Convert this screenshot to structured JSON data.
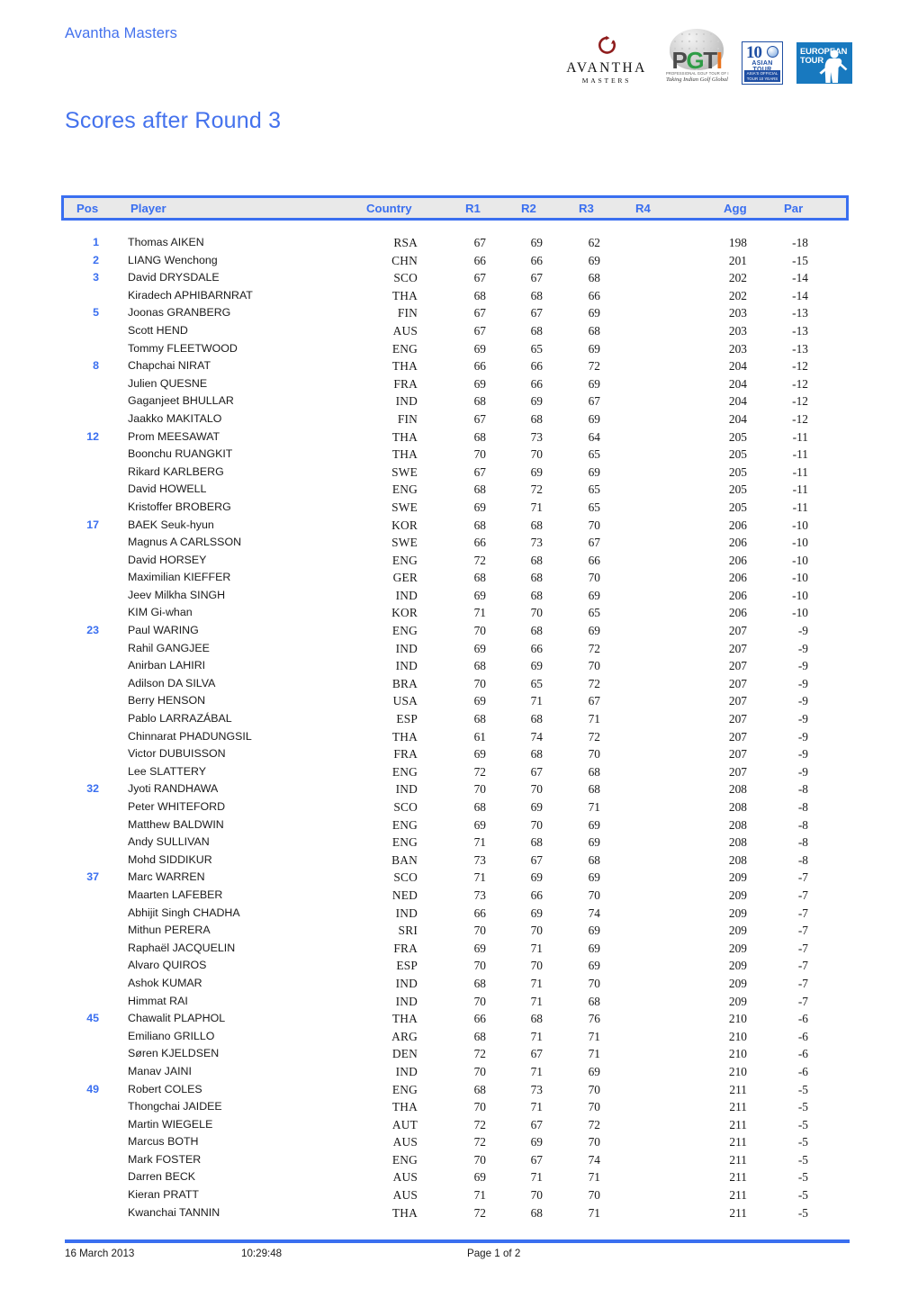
{
  "header": {
    "event_name": "Avantha Masters",
    "logos": [
      {
        "name": "avantha-masters-logo",
        "wordmark": "AVANTHA",
        "submark": "MASTERS"
      },
      {
        "name": "pgti-logo",
        "letters": [
          "P",
          "G",
          "T",
          "I"
        ],
        "tagline": "PROFESSIONAL GOLF TOUR OF INDIA",
        "script": "Taking Indian Golf Global"
      },
      {
        "name": "asian-tour-logo",
        "numeral": "10",
        "word": "ASIAN TOUR",
        "banner": "ASIA'S OFFICIAL TOUR 10 YEARS OF FOUNDATION"
      },
      {
        "name": "european-tour-logo",
        "line1": "EUROPEAN",
        "line2": "TOUR"
      }
    ]
  },
  "title": "Scores after Round 3",
  "table": {
    "columns": [
      {
        "key": "pos",
        "label": "Pos"
      },
      {
        "key": "player",
        "label": "Player"
      },
      {
        "key": "country",
        "label": "Country"
      },
      {
        "key": "r1",
        "label": "R1"
      },
      {
        "key": "r2",
        "label": "R2"
      },
      {
        "key": "r3",
        "label": "R3"
      },
      {
        "key": "r4",
        "label": "R4"
      },
      {
        "key": "agg",
        "label": "Agg"
      },
      {
        "key": "par",
        "label": "Par"
      }
    ],
    "rows": [
      {
        "pos": "1",
        "player": "Thomas AIKEN",
        "country": "RSA",
        "r1": "67",
        "r2": "69",
        "r3": "62",
        "r4": "",
        "agg": "198",
        "par": "-18"
      },
      {
        "pos": "2",
        "player": "LIANG Wenchong",
        "country": "CHN",
        "r1": "66",
        "r2": "66",
        "r3": "69",
        "r4": "",
        "agg": "201",
        "par": "-15"
      },
      {
        "pos": "3",
        "player": "David DRYSDALE",
        "country": "SCO",
        "r1": "67",
        "r2": "67",
        "r3": "68",
        "r4": "",
        "agg": "202",
        "par": "-14"
      },
      {
        "pos": "",
        "player": "Kiradech APHIBARNRAT",
        "country": "THA",
        "r1": "68",
        "r2": "68",
        "r3": "66",
        "r4": "",
        "agg": "202",
        "par": "-14"
      },
      {
        "pos": "5",
        "player": "Joonas GRANBERG",
        "country": "FIN",
        "r1": "67",
        "r2": "67",
        "r3": "69",
        "r4": "",
        "agg": "203",
        "par": "-13"
      },
      {
        "pos": "",
        "player": "Scott HEND",
        "country": "AUS",
        "r1": "67",
        "r2": "68",
        "r3": "68",
        "r4": "",
        "agg": "203",
        "par": "-13"
      },
      {
        "pos": "",
        "player": "Tommy FLEETWOOD",
        "country": "ENG",
        "r1": "69",
        "r2": "65",
        "r3": "69",
        "r4": "",
        "agg": "203",
        "par": "-13"
      },
      {
        "pos": "8",
        "player": "Chapchai NIRAT",
        "country": "THA",
        "r1": "66",
        "r2": "66",
        "r3": "72",
        "r4": "",
        "agg": "204",
        "par": "-12"
      },
      {
        "pos": "",
        "player": "Julien QUESNE",
        "country": "FRA",
        "r1": "69",
        "r2": "66",
        "r3": "69",
        "r4": "",
        "agg": "204",
        "par": "-12"
      },
      {
        "pos": "",
        "player": "Gaganjeet BHULLAR",
        "country": "IND",
        "r1": "68",
        "r2": "69",
        "r3": "67",
        "r4": "",
        "agg": "204",
        "par": "-12"
      },
      {
        "pos": "",
        "player": "Jaakko MAKITALO",
        "country": "FIN",
        "r1": "67",
        "r2": "68",
        "r3": "69",
        "r4": "",
        "agg": "204",
        "par": "-12"
      },
      {
        "pos": "12",
        "player": "Prom MEESAWAT",
        "country": "THA",
        "r1": "68",
        "r2": "73",
        "r3": "64",
        "r4": "",
        "agg": "205",
        "par": "-11"
      },
      {
        "pos": "",
        "player": "Boonchu RUANGKIT",
        "country": "THA",
        "r1": "70",
        "r2": "70",
        "r3": "65",
        "r4": "",
        "agg": "205",
        "par": "-11"
      },
      {
        "pos": "",
        "player": "Rikard KARLBERG",
        "country": "SWE",
        "r1": "67",
        "r2": "69",
        "r3": "69",
        "r4": "",
        "agg": "205",
        "par": "-11"
      },
      {
        "pos": "",
        "player": "David HOWELL",
        "country": "ENG",
        "r1": "68",
        "r2": "72",
        "r3": "65",
        "r4": "",
        "agg": "205",
        "par": "-11"
      },
      {
        "pos": "",
        "player": "Kristoffer BROBERG",
        "country": "SWE",
        "r1": "69",
        "r2": "71",
        "r3": "65",
        "r4": "",
        "agg": "205",
        "par": "-11"
      },
      {
        "pos": "17",
        "player": "BAEK Seuk-hyun",
        "country": "KOR",
        "r1": "68",
        "r2": "68",
        "r3": "70",
        "r4": "",
        "agg": "206",
        "par": "-10"
      },
      {
        "pos": "",
        "player": "Magnus A CARLSSON",
        "country": "SWE",
        "r1": "66",
        "r2": "73",
        "r3": "67",
        "r4": "",
        "agg": "206",
        "par": "-10"
      },
      {
        "pos": "",
        "player": "David HORSEY",
        "country": "ENG",
        "r1": "72",
        "r2": "68",
        "r3": "66",
        "r4": "",
        "agg": "206",
        "par": "-10"
      },
      {
        "pos": "",
        "player": "Maximilian KIEFFER",
        "country": "GER",
        "r1": "68",
        "r2": "68",
        "r3": "70",
        "r4": "",
        "agg": "206",
        "par": "-10"
      },
      {
        "pos": "",
        "player": "Jeev Milkha SINGH",
        "country": "IND",
        "r1": "69",
        "r2": "68",
        "r3": "69",
        "r4": "",
        "agg": "206",
        "par": "-10"
      },
      {
        "pos": "",
        "player": "KIM Gi-whan",
        "country": "KOR",
        "r1": "71",
        "r2": "70",
        "r3": "65",
        "r4": "",
        "agg": "206",
        "par": "-10"
      },
      {
        "pos": "23",
        "player": "Paul WARING",
        "country": "ENG",
        "r1": "70",
        "r2": "68",
        "r3": "69",
        "r4": "",
        "agg": "207",
        "par": "-9"
      },
      {
        "pos": "",
        "player": "Rahil GANGJEE",
        "country": "IND",
        "r1": "69",
        "r2": "66",
        "r3": "72",
        "r4": "",
        "agg": "207",
        "par": "-9"
      },
      {
        "pos": "",
        "player": "Anirban LAHIRI",
        "country": "IND",
        "r1": "68",
        "r2": "69",
        "r3": "70",
        "r4": "",
        "agg": "207",
        "par": "-9"
      },
      {
        "pos": "",
        "player": "Adilson DA SILVA",
        "country": "BRA",
        "r1": "70",
        "r2": "65",
        "r3": "72",
        "r4": "",
        "agg": "207",
        "par": "-9"
      },
      {
        "pos": "",
        "player": "Berry HENSON",
        "country": "USA",
        "r1": "69",
        "r2": "71",
        "r3": "67",
        "r4": "",
        "agg": "207",
        "par": "-9"
      },
      {
        "pos": "",
        "player": "Pablo LARRAZÁBAL",
        "country": "ESP",
        "r1": "68",
        "r2": "68",
        "r3": "71",
        "r4": "",
        "agg": "207",
        "par": "-9"
      },
      {
        "pos": "",
        "player": "Chinnarat PHADUNGSIL",
        "country": "THA",
        "r1": "61",
        "r2": "74",
        "r3": "72",
        "r4": "",
        "agg": "207",
        "par": "-9"
      },
      {
        "pos": "",
        "player": "Victor DUBUISSON",
        "country": "FRA",
        "r1": "69",
        "r2": "68",
        "r3": "70",
        "r4": "",
        "agg": "207",
        "par": "-9"
      },
      {
        "pos": "",
        "player": "Lee SLATTERY",
        "country": "ENG",
        "r1": "72",
        "r2": "67",
        "r3": "68",
        "r4": "",
        "agg": "207",
        "par": "-9"
      },
      {
        "pos": "32",
        "player": "Jyoti RANDHAWA",
        "country": "IND",
        "r1": "70",
        "r2": "70",
        "r3": "68",
        "r4": "",
        "agg": "208",
        "par": "-8"
      },
      {
        "pos": "",
        "player": "Peter WHITEFORD",
        "country": "SCO",
        "r1": "68",
        "r2": "69",
        "r3": "71",
        "r4": "",
        "agg": "208",
        "par": "-8"
      },
      {
        "pos": "",
        "player": "Matthew BALDWIN",
        "country": "ENG",
        "r1": "69",
        "r2": "70",
        "r3": "69",
        "r4": "",
        "agg": "208",
        "par": "-8"
      },
      {
        "pos": "",
        "player": "Andy SULLIVAN",
        "country": "ENG",
        "r1": "71",
        "r2": "68",
        "r3": "69",
        "r4": "",
        "agg": "208",
        "par": "-8"
      },
      {
        "pos": "",
        "player": "Mohd SIDDIKUR",
        "country": "BAN",
        "r1": "73",
        "r2": "67",
        "r3": "68",
        "r4": "",
        "agg": "208",
        "par": "-8"
      },
      {
        "pos": "37",
        "player": "Marc WARREN",
        "country": "SCO",
        "r1": "71",
        "r2": "69",
        "r3": "69",
        "r4": "",
        "agg": "209",
        "par": "-7"
      },
      {
        "pos": "",
        "player": "Maarten LAFEBER",
        "country": "NED",
        "r1": "73",
        "r2": "66",
        "r3": "70",
        "r4": "",
        "agg": "209",
        "par": "-7"
      },
      {
        "pos": "",
        "player": "Abhijit Singh CHADHA",
        "country": "IND",
        "r1": "66",
        "r2": "69",
        "r3": "74",
        "r4": "",
        "agg": "209",
        "par": "-7"
      },
      {
        "pos": "",
        "player": "Mithun PERERA",
        "country": "SRI",
        "r1": "70",
        "r2": "70",
        "r3": "69",
        "r4": "",
        "agg": "209",
        "par": "-7"
      },
      {
        "pos": "",
        "player": "Raphaël JACQUELIN",
        "country": "FRA",
        "r1": "69",
        "r2": "71",
        "r3": "69",
        "r4": "",
        "agg": "209",
        "par": "-7"
      },
      {
        "pos": "",
        "player": "Alvaro QUIROS",
        "country": "ESP",
        "r1": "70",
        "r2": "70",
        "r3": "69",
        "r4": "",
        "agg": "209",
        "par": "-7"
      },
      {
        "pos": "",
        "player": "Ashok KUMAR",
        "country": "IND",
        "r1": "68",
        "r2": "71",
        "r3": "70",
        "r4": "",
        "agg": "209",
        "par": "-7"
      },
      {
        "pos": "",
        "player": "Himmat RAI",
        "country": "IND",
        "r1": "70",
        "r2": "71",
        "r3": "68",
        "r4": "",
        "agg": "209",
        "par": "-7"
      },
      {
        "pos": "45",
        "player": "Chawalit PLAPHOL",
        "country": "THA",
        "r1": "66",
        "r2": "68",
        "r3": "76",
        "r4": "",
        "agg": "210",
        "par": "-6"
      },
      {
        "pos": "",
        "player": "Emiliano GRILLO",
        "country": "ARG",
        "r1": "68",
        "r2": "71",
        "r3": "71",
        "r4": "",
        "agg": "210",
        "par": "-6"
      },
      {
        "pos": "",
        "player": "Søren KJELDSEN",
        "country": "DEN",
        "r1": "72",
        "r2": "67",
        "r3": "71",
        "r4": "",
        "agg": "210",
        "par": "-6"
      },
      {
        "pos": "",
        "player": "Manav JAINI",
        "country": "IND",
        "r1": "70",
        "r2": "71",
        "r3": "69",
        "r4": "",
        "agg": "210",
        "par": "-6"
      },
      {
        "pos": "49",
        "player": "Robert COLES",
        "country": "ENG",
        "r1": "68",
        "r2": "73",
        "r3": "70",
        "r4": "",
        "agg": "211",
        "par": "-5"
      },
      {
        "pos": "",
        "player": "Thongchai JAIDEE",
        "country": "THA",
        "r1": "70",
        "r2": "71",
        "r3": "70",
        "r4": "",
        "agg": "211",
        "par": "-5"
      },
      {
        "pos": "",
        "player": "Martin WIEGELE",
        "country": "AUT",
        "r1": "72",
        "r2": "67",
        "r3": "72",
        "r4": "",
        "agg": "211",
        "par": "-5"
      },
      {
        "pos": "",
        "player": "Marcus BOTH",
        "country": "AUS",
        "r1": "72",
        "r2": "69",
        "r3": "70",
        "r4": "",
        "agg": "211",
        "par": "-5"
      },
      {
        "pos": "",
        "player": "Mark FOSTER",
        "country": "ENG",
        "r1": "70",
        "r2": "67",
        "r3": "74",
        "r4": "",
        "agg": "211",
        "par": "-5"
      },
      {
        "pos": "",
        "player": "Darren BECK",
        "country": "AUS",
        "r1": "69",
        "r2": "71",
        "r3": "71",
        "r4": "",
        "agg": "211",
        "par": "-5"
      },
      {
        "pos": "",
        "player": "Kieran PRATT",
        "country": "AUS",
        "r1": "71",
        "r2": "70",
        "r3": "70",
        "r4": "",
        "agg": "211",
        "par": "-5"
      },
      {
        "pos": "",
        "player": "Kwanchai TANNIN",
        "country": "THA",
        "r1": "72",
        "r2": "68",
        "r3": "71",
        "r4": "",
        "agg": "211",
        "par": "-5"
      }
    ]
  },
  "footer": {
    "date": "16 March 2013",
    "time": "10:29:48",
    "page": "Page 1 of 2"
  },
  "colors": {
    "accent_blue": "#3a6ff0",
    "title_blue": "#4472ed",
    "header_band_bg": "#e9e9e9",
    "text_dark": "#1a1a1a"
  }
}
